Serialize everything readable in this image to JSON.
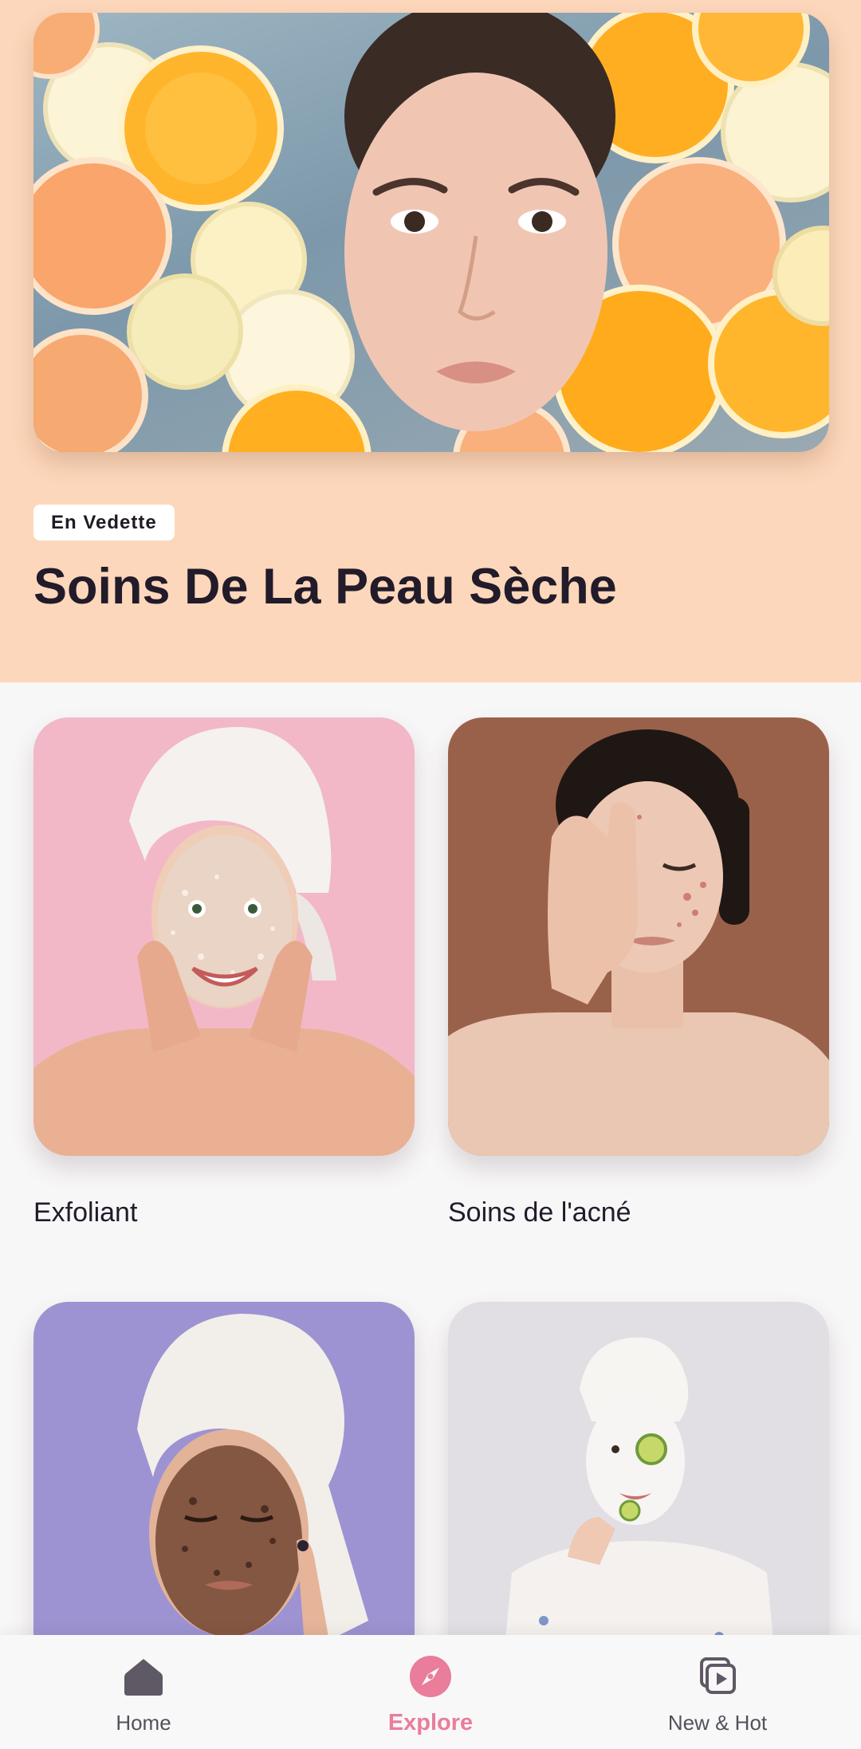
{
  "featured": {
    "badge": "En Vedette",
    "title": "Soins De La Peau Sèche",
    "background_color": "#fdd7bb",
    "image": "woman-face-in-water-with-orange-slices"
  },
  "categories": [
    {
      "label": "Exfoliant",
      "image": "woman-towel-face-scrub-pink-background",
      "background_color": "#f0b3c2"
    },
    {
      "label": "Soins de l'acné",
      "image": "woman-hand-on-face-acne-brown-background",
      "background_color": "#9a614a"
    },
    {
      "label": "",
      "image": "woman-towel-coffee-scrub-purple-background",
      "background_color": "#9d93d2"
    },
    {
      "label": "",
      "image": "woman-face-mask-cucumber-grey-background",
      "background_color": "#e2dfe4"
    }
  ],
  "bottom_nav": {
    "active_color": "#e97d9a",
    "items": [
      {
        "label": "Home",
        "icon": "home-icon",
        "active": false
      },
      {
        "label": "Explore",
        "icon": "compass-icon",
        "active": true
      },
      {
        "label": "New & Hot",
        "icon": "play-library-icon",
        "active": false
      }
    ]
  }
}
